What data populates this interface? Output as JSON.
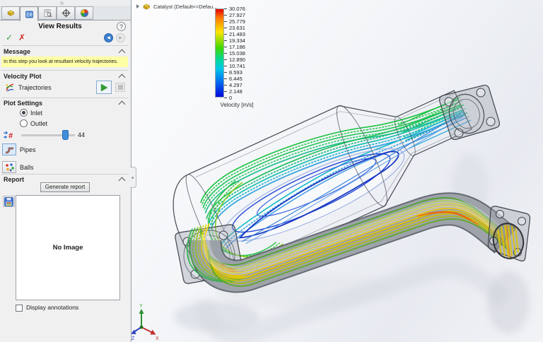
{
  "colors": {
    "accent": "#3a7fd0",
    "panel_bg": "#f0f0f1",
    "message_bg": "#ffffa6",
    "ok_green": "#2ea043",
    "cancel_red": "#d02b20"
  },
  "panel": {
    "tabs": [
      {
        "name": "feature-manager"
      },
      {
        "name": "property-manager",
        "active": true
      },
      {
        "name": "configuration-manager"
      },
      {
        "name": "dimxpert-manager"
      },
      {
        "name": "display-manager"
      }
    ],
    "title": "View Results",
    "help_glyph": "?",
    "ok_glyph": "✓",
    "cancel_glyph": "✗",
    "message": {
      "header": "Message",
      "text": "In this step you look at resultant velocity trajectories."
    },
    "velocity_plot": {
      "header": "Velocity Plot",
      "item_label": "Trajectories"
    },
    "plot_settings": {
      "header": "Plot Settings",
      "inlet_label": "Inlet",
      "outlet_label": "Outlet",
      "inlet_selected": true,
      "slider_value": "44",
      "pipes_label": "Pipes",
      "balls_label": "Balls"
    },
    "report": {
      "header": "Report",
      "generate_button": "Generate report",
      "no_image": "No Image",
      "display_annotations": "Display annotations"
    }
  },
  "graphics": {
    "tree_item": "Catalyst (Default<<Defau...",
    "legend": {
      "title": "Velocity [m/s]",
      "ticks": [
        "30.076",
        "27.927",
        "25.779",
        "23.631",
        "21.483",
        "19.334",
        "17.186",
        "15.038",
        "12.890",
        "10.741",
        "8.593",
        "6.445",
        "4.297",
        "2.148",
        "0"
      ],
      "gradient": [
        {
          "c": "#e40000",
          "p": 0
        },
        {
          "c": "#ff7a00",
          "p": 10
        },
        {
          "c": "#ffe400",
          "p": 26
        },
        {
          "c": "#42d800",
          "p": 44
        },
        {
          "c": "#00d8a0",
          "p": 58
        },
        {
          "c": "#00c8e8",
          "p": 68
        },
        {
          "c": "#0072f0",
          "p": 82
        },
        {
          "c": "#0008dc",
          "p": 100
        }
      ]
    },
    "triad": {
      "x_label": "X",
      "y_label": "Y",
      "z_label": "Z"
    }
  }
}
